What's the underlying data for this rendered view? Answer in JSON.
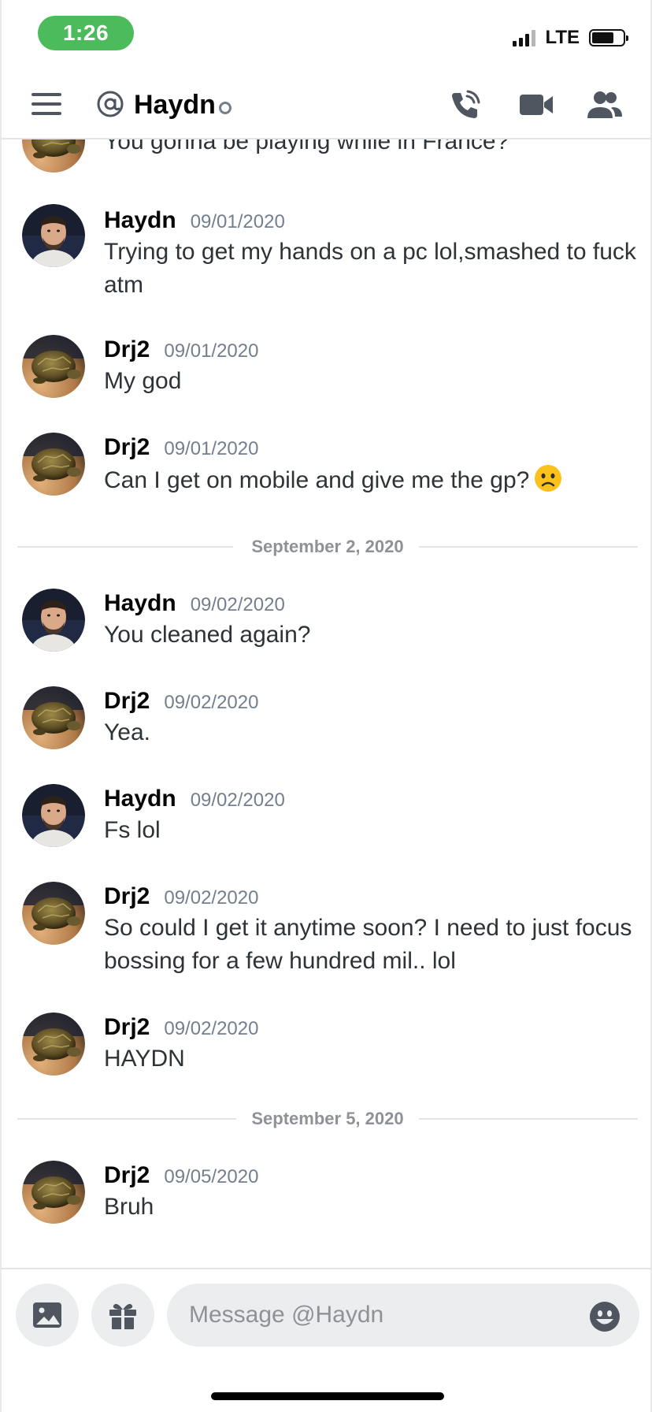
{
  "status_bar": {
    "time": "1:26",
    "network": "LTE",
    "battery_level": 0.7
  },
  "header": {
    "title": "Haydn",
    "menu_icon": "hamburger-icon",
    "at_icon": "at-icon",
    "call_icon": "phone-call-icon",
    "video_icon": "video-camera-icon",
    "members_icon": "members-icon"
  },
  "messages": [
    {
      "author": "",
      "timestamp": "",
      "text": "You gonna be playing while in France?",
      "avatar": "turtle"
    },
    {
      "author": "Haydn",
      "timestamp": "09/01/2020",
      "text": "Trying to get my hands on a pc lol,smashed to fuck atm",
      "avatar": "man"
    },
    {
      "author": "Drj2",
      "timestamp": "09/01/2020",
      "text": "My god",
      "avatar": "turtle"
    },
    {
      "author": "Drj2",
      "timestamp": "09/01/2020",
      "text": "Can I get on mobile and give me the gp?",
      "avatar": "turtle",
      "emoji": "frowning-face-emoji"
    },
    {
      "author": "Haydn",
      "timestamp": "09/02/2020",
      "text": "You cleaned again?",
      "avatar": "man"
    },
    {
      "author": "Drj2",
      "timestamp": "09/02/2020",
      "text": "Yea.",
      "avatar": "turtle"
    },
    {
      "author": "Haydn",
      "timestamp": "09/02/2020",
      "text": "Fs lol",
      "avatar": "man"
    },
    {
      "author": "Drj2",
      "timestamp": "09/02/2020",
      "text": "So could I get it anytime soon? I need to just focus bossing for a few hundred mil.. lol",
      "avatar": "turtle"
    },
    {
      "author": "Drj2",
      "timestamp": "09/02/2020",
      "text": "HAYDN",
      "avatar": "turtle"
    },
    {
      "author": "Drj2",
      "timestamp": "09/05/2020",
      "text": "Bruh",
      "avatar": "turtle"
    }
  ],
  "dividers": [
    "September 2, 2020",
    "September 5, 2020"
  ],
  "composer": {
    "placeholder": "Message @Haydn",
    "image_icon": "image-icon",
    "gift_icon": "gift-icon",
    "emoji_icon": "smiley-icon"
  },
  "colors": {
    "status_green": "#4cbb5b",
    "text": "#2e3338",
    "muted": "#747f8d",
    "input_bg": "#ebedef"
  }
}
